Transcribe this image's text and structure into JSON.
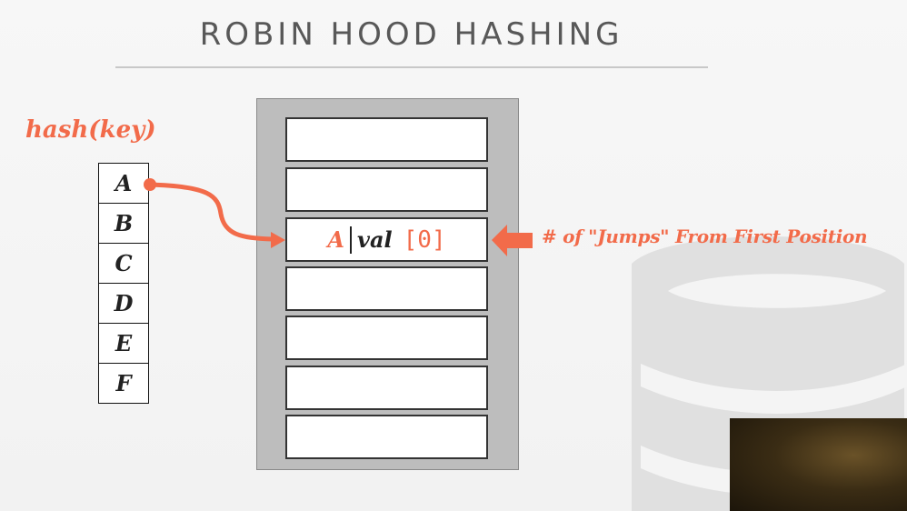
{
  "slide": {
    "title": "ROBIN HOOD HASHING"
  },
  "hash": {
    "label": "hash(key)",
    "keys": [
      "A",
      "B",
      "C",
      "D",
      "E",
      "F"
    ]
  },
  "table": {
    "filled_slot": {
      "key": "A",
      "value": "val",
      "jumps": "[0]"
    }
  },
  "annotation": {
    "text": "# of \"Jumps\" From First Position"
  },
  "colors": {
    "accent": "#f26b4a",
    "title": "#585858",
    "table_bg": "#bdbdbd"
  }
}
